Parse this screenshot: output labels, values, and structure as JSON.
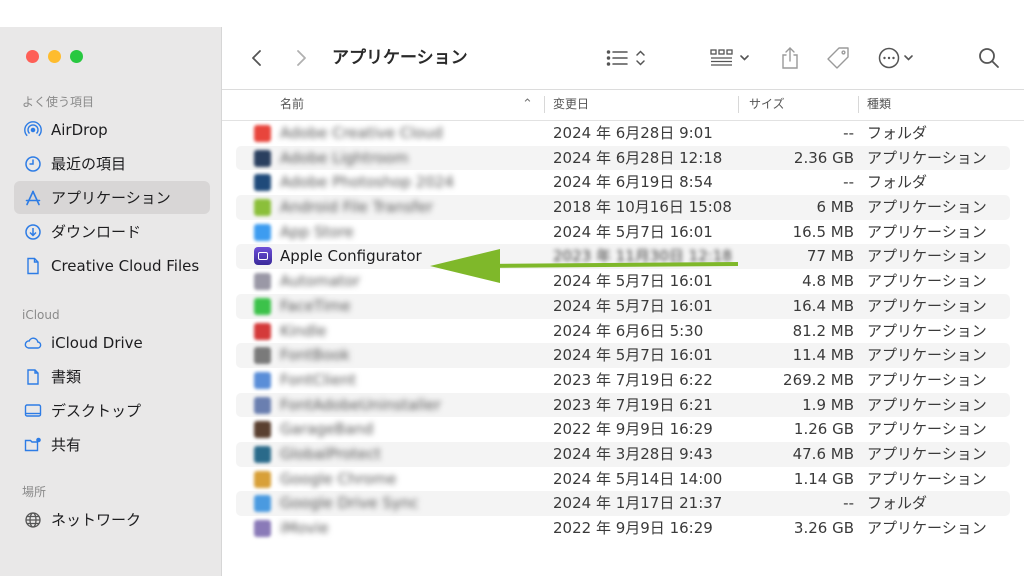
{
  "sidebar": {
    "favorites_header": "よく使う項目",
    "favorites": [
      {
        "label": "AirDrop",
        "icon": "airdrop-icon"
      },
      {
        "label": "最近の項目",
        "icon": "clock-icon"
      },
      {
        "label": "アプリケーション",
        "icon": "applications-icon",
        "selected": true
      },
      {
        "label": "ダウンロード",
        "icon": "download-icon"
      },
      {
        "label": "Creative Cloud Files",
        "icon": "document-icon"
      }
    ],
    "icloud_header": "iCloud",
    "icloud": [
      {
        "label": "iCloud Drive",
        "icon": "cloud-icon"
      },
      {
        "label": "書類",
        "icon": "document-icon"
      },
      {
        "label": "デスクトップ",
        "icon": "desktop-icon"
      },
      {
        "label": "共有",
        "icon": "shared-folder-icon"
      }
    ],
    "locations_header": "場所",
    "locations": [
      {
        "label": "ネットワーク",
        "icon": "network-icon"
      }
    ]
  },
  "toolbar": {
    "title": "アプリケーション"
  },
  "columns": {
    "name": "名前",
    "date": "変更日",
    "size": "サイズ",
    "kind": "種類"
  },
  "files": [
    {
      "name": "Adobe Creative Cloud",
      "date": "2024 年 6月28日 9:01",
      "size": "--",
      "kind": "フォルダ",
      "icon_color": "#e8453c",
      "blurred": true
    },
    {
      "name": "Adobe Lightroom",
      "date": "2024 年 6月28日 12:18",
      "size": "2.36 GB",
      "kind": "アプリケーション",
      "icon_color": "#2a3f5f",
      "blurred": true
    },
    {
      "name": "Adobe Photoshop 2024",
      "date": "2024 年 6月19日 8:54",
      "size": "--",
      "kind": "フォルダ",
      "icon_color": "#1f4a7a",
      "blurred": true
    },
    {
      "name": "Android File Transfer",
      "date": "2018 年 10月16日 15:08",
      "size": "6 MB",
      "kind": "アプリケーション",
      "icon_color": "#8bbf3a",
      "blurred": true
    },
    {
      "name": "App Store",
      "date": "2024 年 5月7日 16:01",
      "size": "16.5 MB",
      "kind": "アプリケーション",
      "icon_color": "#3d9cf0",
      "blurred": true
    },
    {
      "name": "Apple Configurator",
      "date": "2023 年 11月30日 12:18",
      "size": "77 MB",
      "kind": "アプリケーション",
      "icon_color": "#5a3fc8",
      "blurred": false,
      "date_blurred": true
    },
    {
      "name": "Automator",
      "date": "2024 年 5月7日 16:01",
      "size": "4.8 MB",
      "kind": "アプリケーション",
      "icon_color": "#9a98a6",
      "blurred": true
    },
    {
      "name": "FaceTime",
      "date": "2024 年 5月7日 16:01",
      "size": "16.4 MB",
      "kind": "アプリケーション",
      "icon_color": "#3cc24a",
      "blurred": true
    },
    {
      "name": "Kindle",
      "date": "2024 年 6月6日 5:30",
      "size": "81.2 MB",
      "kind": "アプリケーション",
      "icon_color": "#d43a3a",
      "blurred": true
    },
    {
      "name": "FontBook",
      "date": "2024 年 5月7日 16:01",
      "size": "11.4 MB",
      "kind": "アプリケーション",
      "icon_color": "#7a7a7a",
      "blurred": true
    },
    {
      "name": "FontClient",
      "date": "2023 年 7月19日 6:22",
      "size": "269.2 MB",
      "kind": "アプリケーション",
      "icon_color": "#5a8ed8",
      "blurred": true
    },
    {
      "name": "FontAdobeUninstaller",
      "date": "2023 年 7月19日 6:21",
      "size": "1.9 MB",
      "kind": "アプリケーション",
      "icon_color": "#6a7fb0",
      "blurred": true
    },
    {
      "name": "GarageBand",
      "date": "2022 年 9月9日 16:29",
      "size": "1.26 GB",
      "kind": "アプリケーション",
      "icon_color": "#5a4030",
      "blurred": true
    },
    {
      "name": "GlobalProtect",
      "date": "2024 年 3月28日 9:43",
      "size": "47.6 MB",
      "kind": "アプリケーション",
      "icon_color": "#2a6a8a",
      "blurred": true
    },
    {
      "name": "Google Chrome",
      "date": "2024 年 5月14日 14:00",
      "size": "1.14 GB",
      "kind": "アプリケーション",
      "icon_color": "#d8a038",
      "blurred": true
    },
    {
      "name": "Google Drive Sync",
      "date": "2024 年 1月17日 21:37",
      "size": "--",
      "kind": "フォルダ",
      "icon_color": "#4a9ae0",
      "blurred": true
    },
    {
      "name": "iMovie",
      "date": "2022 年 9月9日 16:29",
      "size": "3.26 GB",
      "kind": "アプリケーション",
      "icon_color": "#8a7ab8",
      "blurred": true
    }
  ],
  "colors": {
    "arrow": "#7fb82a",
    "selection": "#d8d6d6",
    "accent": "#2d7ce5"
  }
}
